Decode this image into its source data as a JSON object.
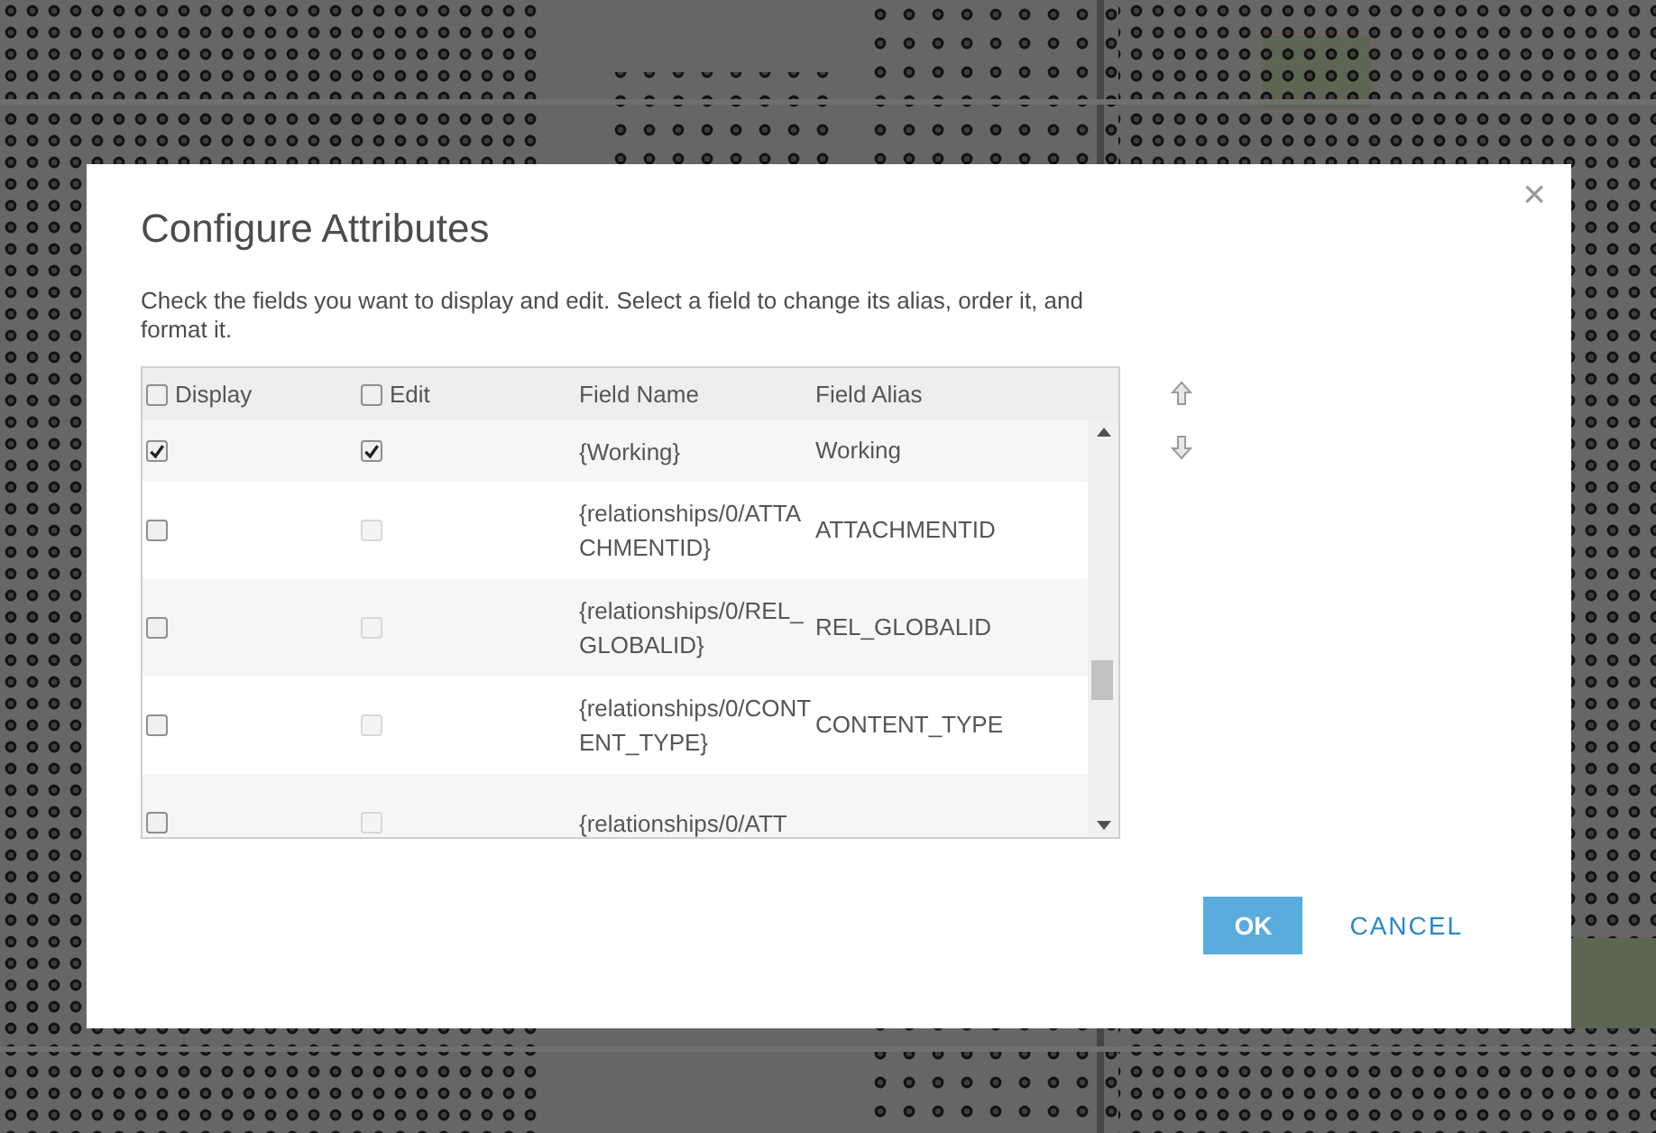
{
  "dialog": {
    "title": "Configure Attributes",
    "description": "Check the fields you want to display and edit. Select a field to change its alias, order it, and format it.",
    "close": "×"
  },
  "table": {
    "columns": [
      {
        "label": "Display",
        "checked": false
      },
      {
        "label": "Edit",
        "checked": false
      },
      {
        "label": "Field Name"
      },
      {
        "label": "Field Alias"
      }
    ],
    "rows": [
      {
        "display": true,
        "edit": true,
        "edit_disabled": false,
        "field_name": "{Working}",
        "field_alias": "Working"
      },
      {
        "display": false,
        "edit": false,
        "edit_disabled": true,
        "field_name": "{relationships/0/ATTACHMENTID}",
        "field_alias": "ATTACHMENTID"
      },
      {
        "display": false,
        "edit": false,
        "edit_disabled": true,
        "field_name": "{relationships/0/REL_GLOBALID}",
        "field_alias": "REL_GLOBALID"
      },
      {
        "display": false,
        "edit": false,
        "edit_disabled": true,
        "field_name": "{relationships/0/CONTENT_TYPE}",
        "field_alias": "CONTENT_TYPE"
      },
      {
        "display": false,
        "edit": false,
        "edit_disabled": true,
        "field_name": "{relationships/0/ATT"
      }
    ]
  },
  "buttons": [
    {
      "label": "OK",
      "kind": "primary"
    },
    {
      "label": "CANCEL",
      "kind": "link"
    }
  ]
}
